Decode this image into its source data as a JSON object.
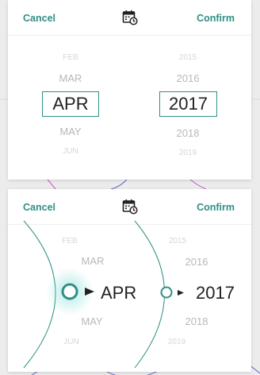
{
  "top_picker": {
    "cancel_label": "Cancel",
    "confirm_label": "Confirm",
    "calendar_icon": "calendar-clock-icon",
    "months": [
      "FEB",
      "MAR",
      "APR",
      "MAY",
      "JUN"
    ],
    "years": [
      "2015",
      "2016",
      "2017",
      "2018",
      "2019"
    ],
    "selected_month": "APR",
    "selected_year": "2017"
  },
  "bottom_picker": {
    "cancel_label": "Cancel",
    "confirm_label": "Confirm",
    "calendar_icon": "calendar-clock-icon",
    "months": [
      "FEB",
      "MAR",
      "APR",
      "MAY",
      "JUN"
    ],
    "years": [
      "2015",
      "2016",
      "2017",
      "2018",
      "2019"
    ],
    "selected_month": "APR",
    "selected_year": "2017"
  },
  "colors": {
    "accent": "#2e8f86",
    "muted_text": "#b8b8b8",
    "background": "#ececec",
    "panel": "#ffffff"
  }
}
